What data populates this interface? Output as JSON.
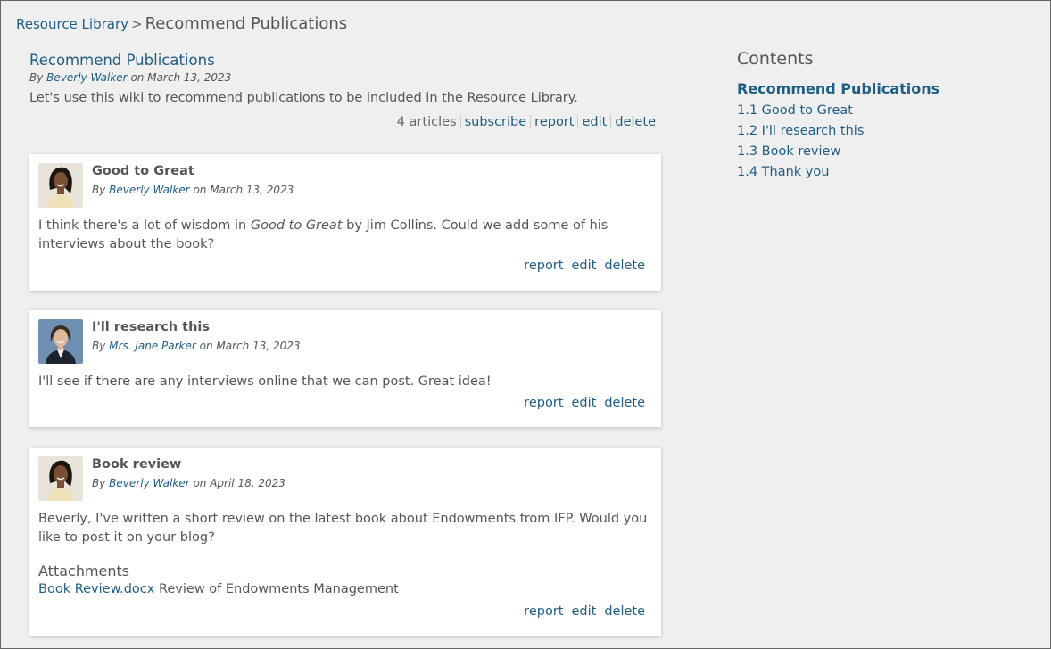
{
  "breadcrumb": {
    "parent": "Resource Library",
    "separator": ">",
    "current": "Recommend Publications"
  },
  "wiki": {
    "title": "Recommend Publications",
    "by": "By",
    "author": "Beverly Walker",
    "on": "on March 13, 2023",
    "description": "Let's use this wiki to recommend publications to be included in the Resource Library.",
    "article_count": "4 articles",
    "actions": {
      "subscribe": "subscribe",
      "report": "report",
      "edit": "edit",
      "delete": "delete"
    }
  },
  "articles": [
    {
      "title": "Good to Great",
      "by": "By",
      "author": "Beverly Walker",
      "on": "on March 13, 2023",
      "body_pre": "I think there's a lot of wisdom in ",
      "body_em": "Good to Great",
      "body_post": " by Jim Collins. Could we add some of his interviews about the book?",
      "actions": {
        "report": "report",
        "edit": "edit",
        "delete": "delete"
      }
    },
    {
      "title": "I'll research this",
      "by": "By",
      "author": "Mrs. Jane Parker",
      "on": "on March 13, 2023",
      "body": "I'll see if there are any interviews online that we can post. Great idea!",
      "actions": {
        "report": "report",
        "edit": "edit",
        "delete": "delete"
      }
    },
    {
      "title": "Book review",
      "by": "By",
      "author": "Beverly Walker",
      "on": "on April 18, 2023",
      "body": "Beverly, I've written a short review on the latest book about Endowments from IFP. Would you like to post it on your blog?",
      "attachments_heading": "Attachments",
      "attachment": {
        "file": "Book Review.docx",
        "description": "Review of Endowments Management"
      },
      "actions": {
        "report": "report",
        "edit": "edit",
        "delete": "delete"
      }
    }
  ],
  "contents": {
    "heading": "Contents",
    "top": "Recommend Publications",
    "items": [
      "1.1 Good to Great",
      "1.2 I'll research this",
      "1.3 Book review",
      "1.4 Thank you"
    ]
  },
  "colors": {
    "link": "#1e5e84",
    "text": "#555555",
    "background": "#efefef",
    "card": "#ffffff"
  }
}
